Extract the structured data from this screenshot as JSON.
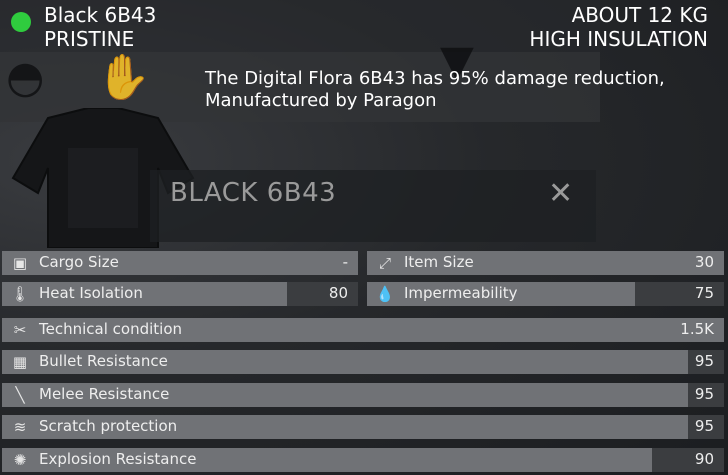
{
  "header": {
    "item_name": "Black 6B43",
    "condition": "PRISTINE",
    "weight": "ABOUT 12 KG",
    "insulation": "HIGH INSULATION",
    "status_color": "#2fcc3e"
  },
  "description": {
    "line1": "The Digital Flora 6B43 has 95% damage reduction,",
    "line2": "Manufactured by Paragon"
  },
  "inspect_panel": {
    "title": "BLACK 6B43",
    "close_icon": "close-icon"
  },
  "stats_small": [
    {
      "icon": "cargo-box-icon",
      "label": "Cargo Size",
      "value": "-",
      "fill": 1.0
    },
    {
      "icon": "item-size-icon",
      "label": "Item Size",
      "value": "30",
      "fill": 1.0
    },
    {
      "icon": "thermometer-icon",
      "label": "Heat Isolation",
      "value": "80",
      "fill": 0.8
    },
    {
      "icon": "water-drops-icon",
      "label": "Impermeability",
      "value": "75",
      "fill": 0.75
    }
  ],
  "stats_wide": [
    {
      "icon": "wrench-icon",
      "label": "Technical condition",
      "value": "1.5K",
      "fill": 1.0
    },
    {
      "icon": "vest-icon",
      "label": "Bullet Resistance",
      "value": "95",
      "fill": 0.95
    },
    {
      "icon": "knife-icon",
      "label": "Melee Resistance",
      "value": "95",
      "fill": 0.95
    },
    {
      "icon": "scratch-icon",
      "label": "Scratch protection",
      "value": "95",
      "fill": 0.95
    },
    {
      "icon": "explosion-icon",
      "label": "Explosion Resistance",
      "value": "90",
      "fill": 0.9
    }
  ]
}
